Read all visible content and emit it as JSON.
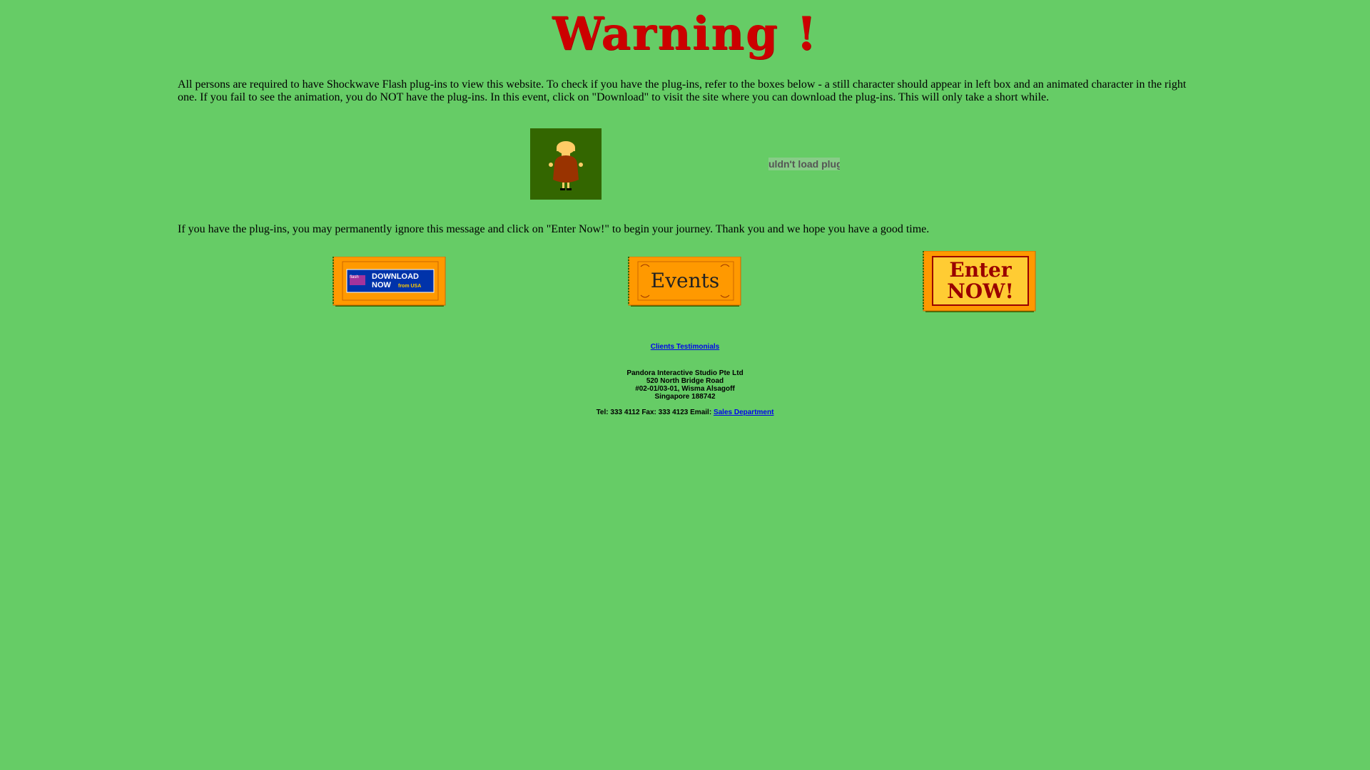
{
  "page": {
    "heading": "Warning !",
    "intro_text": "All persons are required to have Shockwave Flash plug-ins to view this website. To check if you have the plug-ins, refer to the boxes below - a still character should appear in left box and an animated character in the right one. If you fail to see the animation, you do NOT have the plug-ins. In this event, click on \"Download\" to visit the site where you can download the plug-ins. This will only take a short while.",
    "plugin_message": "uldn't load plug",
    "continue_text": "If you have the plug-ins, you may permanently ignore this message and click on \"Enter Now!\" to begin your journey. Thank you and we hope you have a good time."
  },
  "buttons": {
    "download": {
      "line1": "DOWNLOAD",
      "line2": "NOW",
      "sub": "from USA"
    },
    "events": {
      "label": "Events"
    },
    "enter": {
      "line1": "Enter",
      "line2": "NOW!"
    }
  },
  "footer": {
    "testimonials_link": "Clients Testimonials",
    "company": "Pandora Interactive Studio Pte Ltd",
    "address1": "520 North Bridge Road",
    "address2": "#02-01/03-01, Wisma Alsagoff",
    "address3": "Singapore 188742",
    "contact_text": "Tel: 333 4112 Fax: 333 4123 Email:",
    "email_link": "Sales Department"
  },
  "colors": {
    "background": "#66cc66",
    "heading": "#cc0000",
    "ticket": "#ff9900",
    "ticket_dark": "#336600",
    "link": "#0000ee"
  }
}
